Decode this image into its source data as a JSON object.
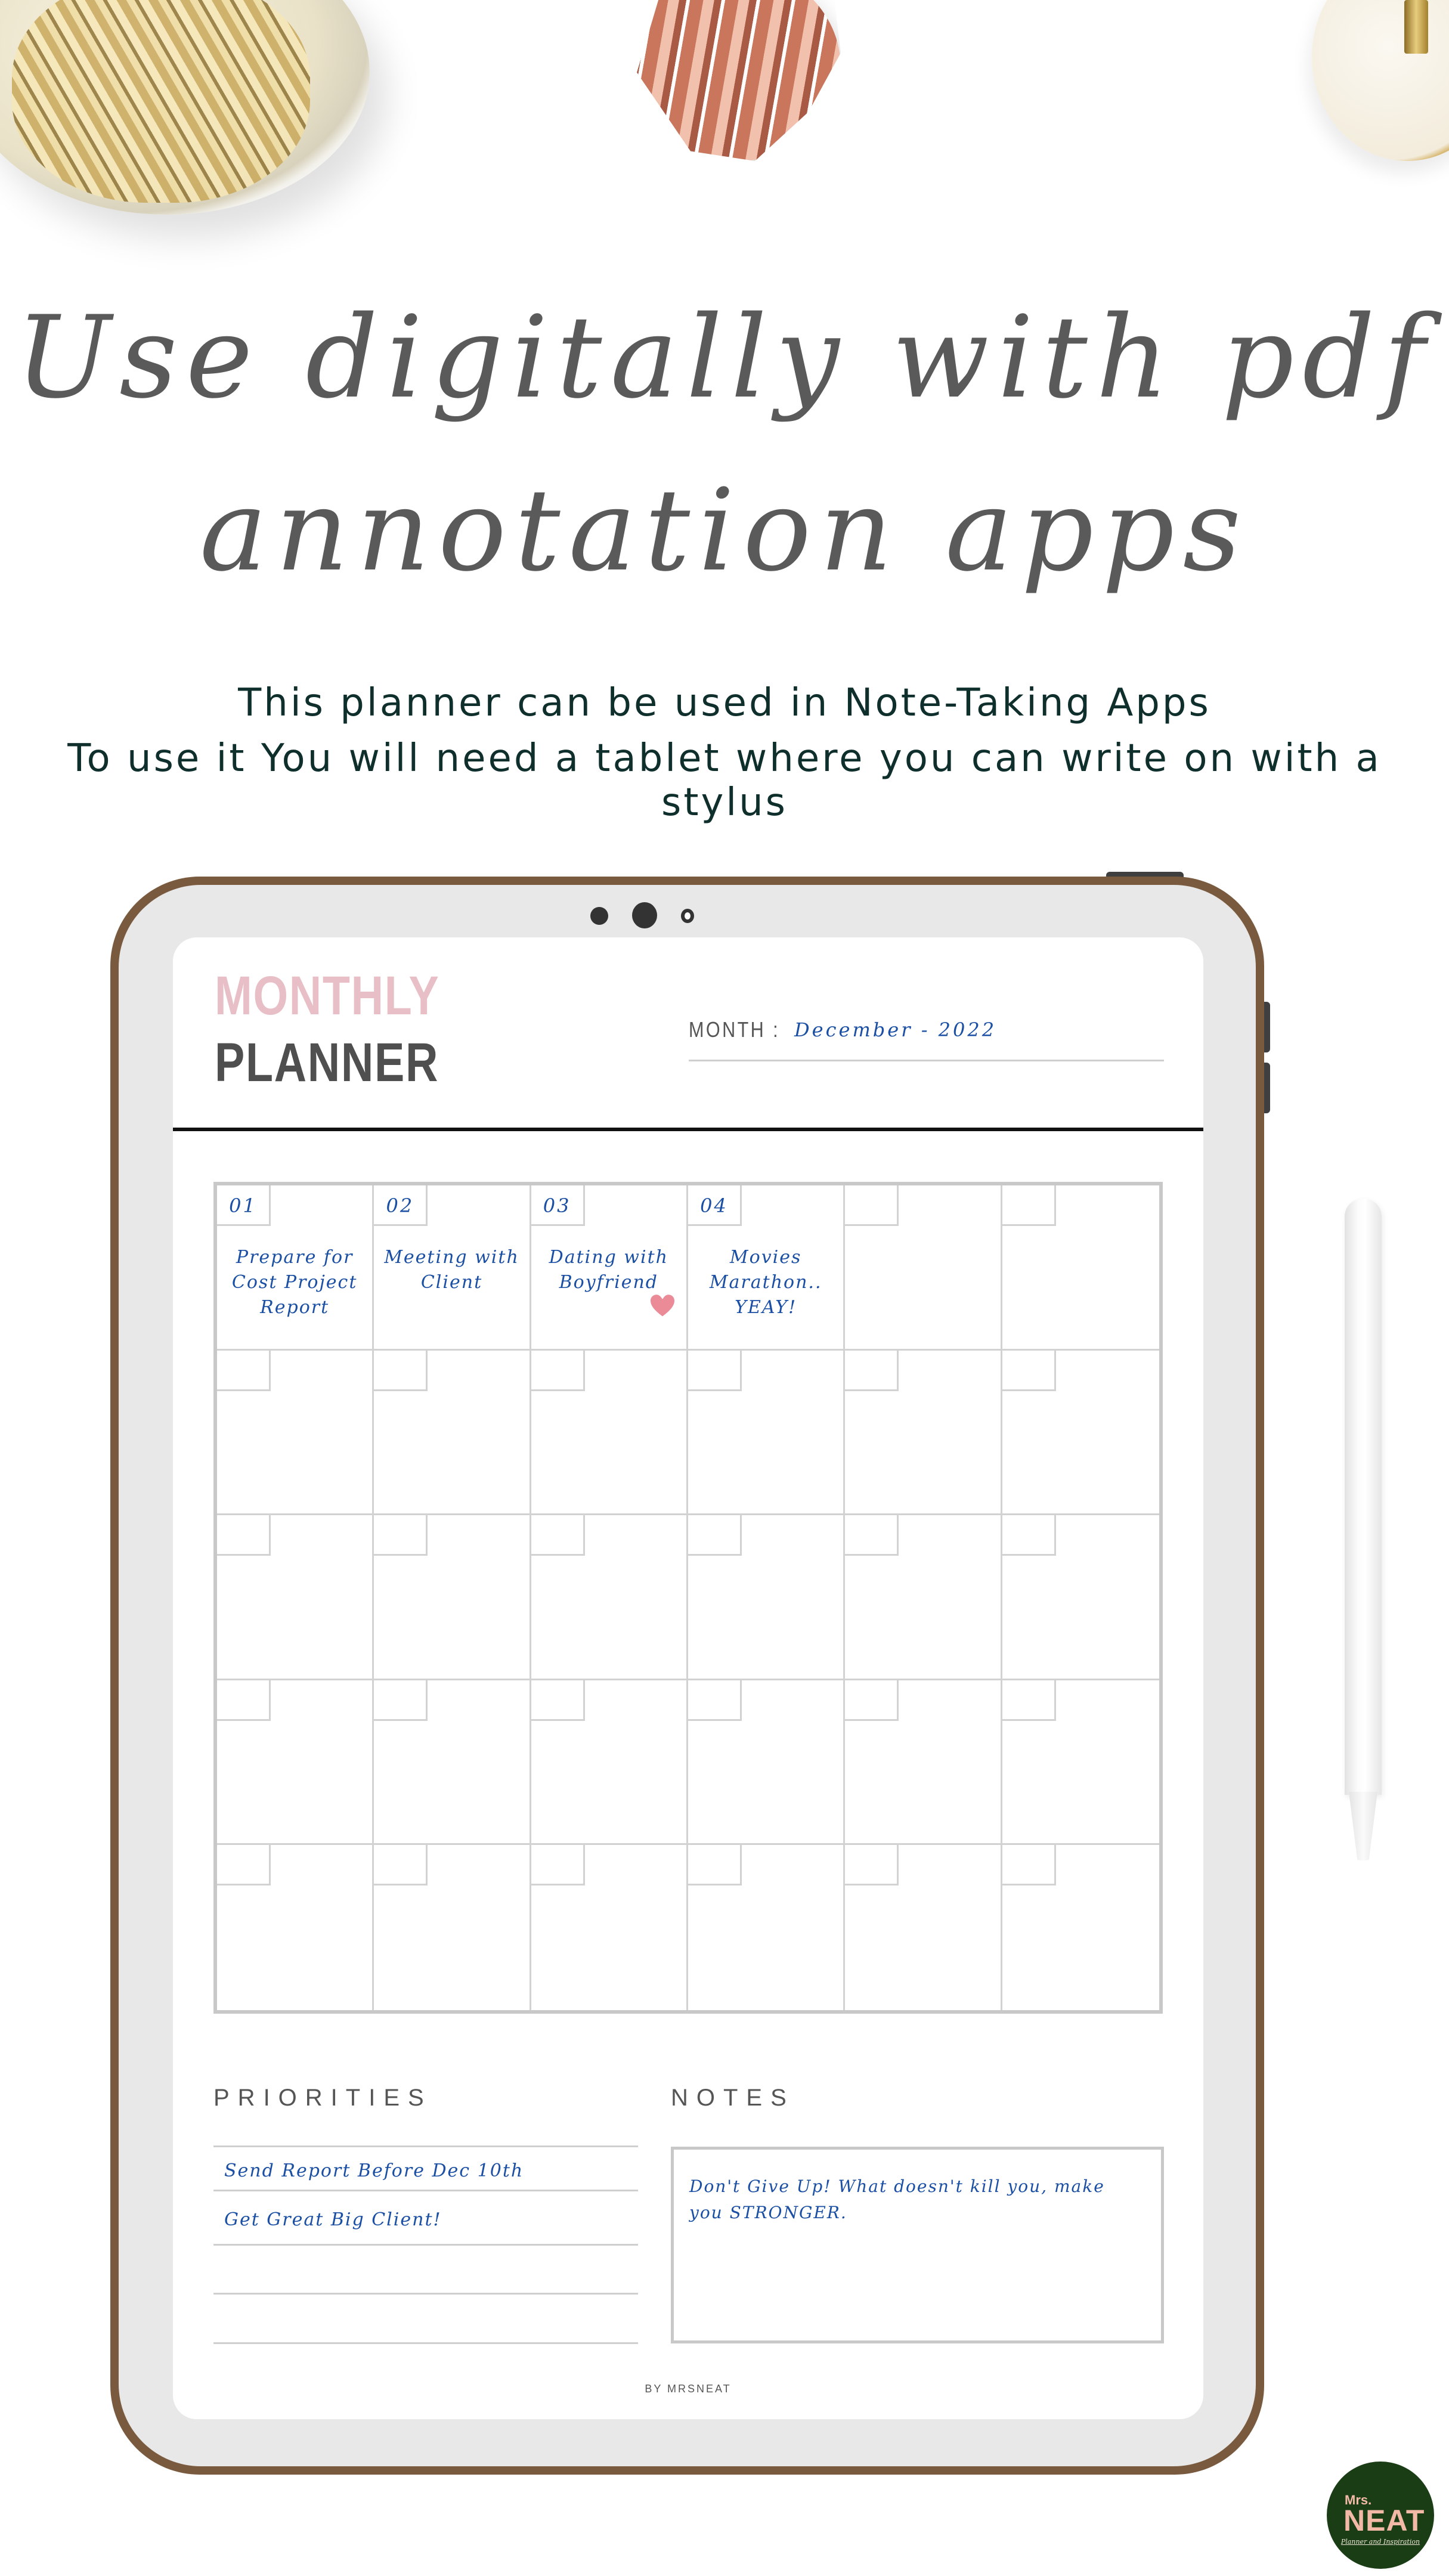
{
  "headline": {
    "line1": "Use digitally with pdf",
    "line2": "annotation apps"
  },
  "subheadline": {
    "line1": "This planner can be used in Note-Taking Apps",
    "line2": "To use it You will need a tablet where you can write on with a stylus"
  },
  "planner": {
    "title_top": "MONTHLY",
    "title_bottom": "PLANNER",
    "month_label": "MONTH :",
    "month_value": "December - 2022",
    "calendar": {
      "columns": 6,
      "rows": 5,
      "filled_days": [
        {
          "date": "01",
          "event": "Prepare for Cost Project Report"
        },
        {
          "date": "02",
          "event": "Meeting with Client"
        },
        {
          "date": "03",
          "event": "Dating with Boyfriend",
          "icon": "heart-icon"
        },
        {
          "date": "04",
          "event": "Movies Marathon.. YEAY!"
        }
      ]
    },
    "priorities": {
      "title": "PRIORITIES",
      "items": [
        "Send Report Before Dec 10th",
        "Get Great Big Client!",
        "",
        ""
      ]
    },
    "notes": {
      "title": "NOTES",
      "text": "Don't Give Up! What doesn't kill you, make you STRONGER."
    },
    "byline": "BY MRSNEAT"
  },
  "logo": {
    "line1": "Mrs.",
    "line2": "NEAT",
    "tagline": "Planner and Inspiration"
  },
  "colors": {
    "frame": "#7a5a3e",
    "bezel": "#e8e8e8",
    "title_pink": "#e8bfc6",
    "title_dark": "#4f4f4f",
    "handwriting_blue": "#1a4fa3",
    "subheading": "#0e2f2c",
    "logo_green": "#1a3d16",
    "logo_pink": "#f2b9a6"
  }
}
